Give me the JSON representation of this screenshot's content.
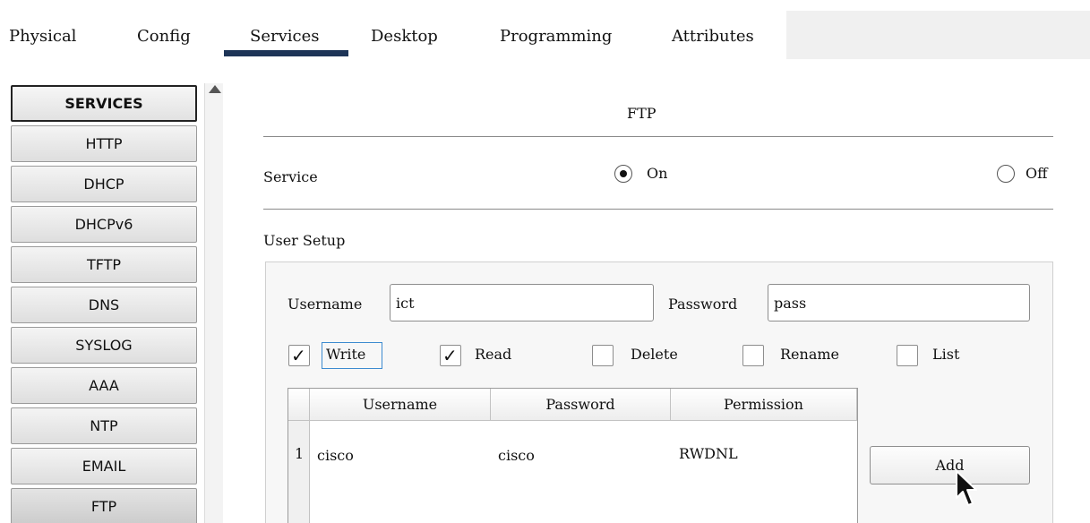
{
  "tabs": [
    {
      "label": "Physical"
    },
    {
      "label": "Config"
    },
    {
      "label": "Services"
    },
    {
      "label": "Desktop"
    },
    {
      "label": "Programming"
    },
    {
      "label": "Attributes"
    }
  ],
  "active_tab": "Services",
  "sidebar": {
    "header": "SERVICES",
    "items": [
      "HTTP",
      "DHCP",
      "DHCPv6",
      "TFTP",
      "DNS",
      "SYSLOG",
      "AAA",
      "NTP",
      "EMAIL",
      "FTP"
    ],
    "selected": "FTP"
  },
  "panel": {
    "title": "FTP",
    "service_label": "Service",
    "on_label": "On",
    "off_label": "Off",
    "service_state": "On",
    "user_setup_label": "User Setup",
    "username_label": "Username",
    "username_value": "ict",
    "password_label": "Password",
    "password_value": "pass",
    "permissions": [
      {
        "label": "Write",
        "checked": true
      },
      {
        "label": "Read",
        "checked": true
      },
      {
        "label": "Delete",
        "checked": false
      },
      {
        "label": "Rename",
        "checked": false
      },
      {
        "label": "List",
        "checked": false
      }
    ],
    "table": {
      "headers": [
        "Username",
        "Password",
        "Permission"
      ],
      "rows": [
        {
          "index": "1",
          "username": "cisco",
          "password": "cisco",
          "permission": "RWDNL"
        }
      ]
    },
    "add_label": "Add"
  }
}
